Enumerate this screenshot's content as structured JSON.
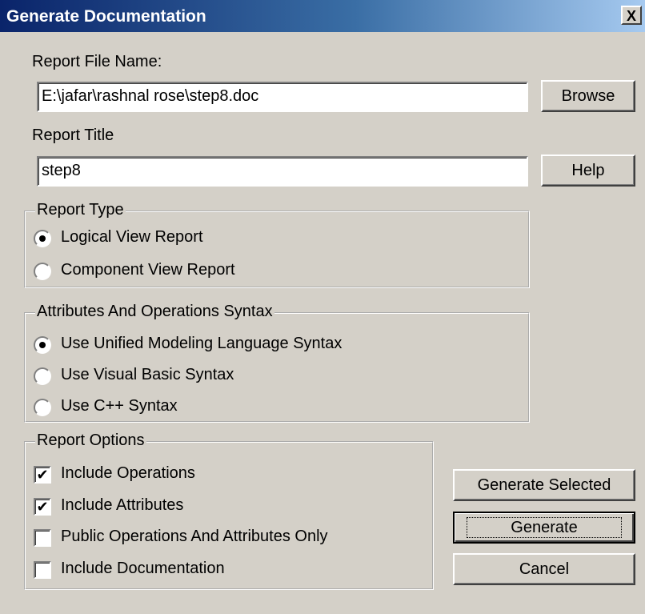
{
  "window": {
    "title": "Generate Documentation",
    "close_label": "X"
  },
  "file": {
    "label": "Report File Name:",
    "value": "E:\\jafar\\rashnal rose\\step8.doc",
    "browse_label": "Browse"
  },
  "report_title": {
    "label": "Report Title",
    "value": "step8",
    "help_label": "Help"
  },
  "report_type": {
    "legend": "Report Type",
    "options": [
      {
        "label": "Logical View Report",
        "selected": true
      },
      {
        "label": "Component View Report",
        "selected": false
      }
    ]
  },
  "syntax": {
    "legend": "Attributes And Operations Syntax",
    "options": [
      {
        "label": "Use Unified Modeling Language Syntax",
        "selected": true
      },
      {
        "label": "Use Visual Basic Syntax",
        "selected": false
      },
      {
        "label": "Use C++ Syntax",
        "selected": false
      }
    ]
  },
  "report_options": {
    "legend": "Report Options",
    "items": [
      {
        "label": "Include Operations",
        "checked": true
      },
      {
        "label": "Include Attributes",
        "checked": true
      },
      {
        "label": "Public Operations And Attributes Only",
        "checked": false
      },
      {
        "label": "Include Documentation",
        "checked": false
      }
    ]
  },
  "buttons": {
    "generate_selected": "Generate Selected",
    "generate": "Generate",
    "cancel": "Cancel"
  },
  "check_glyph": "✔"
}
